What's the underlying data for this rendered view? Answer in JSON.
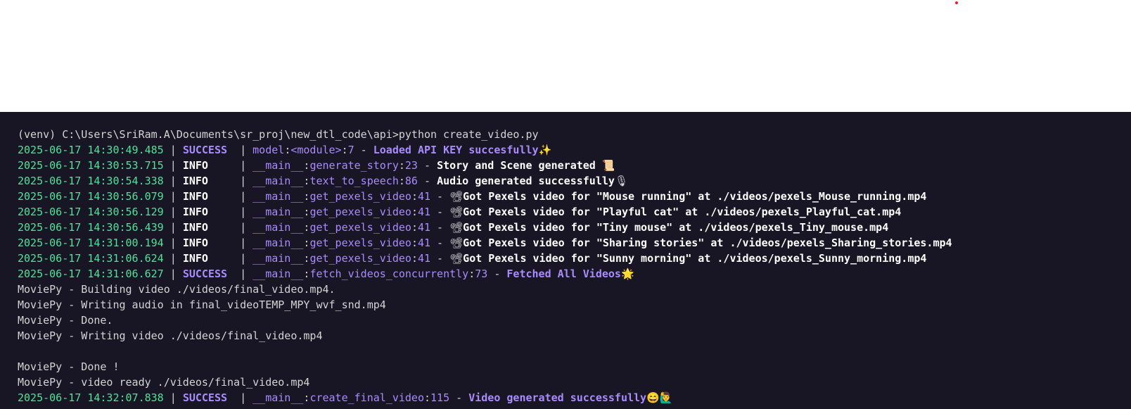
{
  "terminal": {
    "command_line": "(venv) C:\\Users\\SriRam.A\\Documents\\sr_proj\\new_dtl_code\\api>python create_video.py",
    "log_lines": [
      {
        "timestamp": "2025-06-17 14:30:49.485",
        "level": "SUCCESS ",
        "module": "model",
        "function": "<module>",
        "line": "7",
        "message": "Loaded API KEY succesfully",
        "emoji": "✨",
        "kind": "success"
      },
      {
        "timestamp": "2025-06-17 14:30:53.715",
        "level": "INFO    ",
        "module": "__main__",
        "function": "generate_story",
        "line": "23",
        "message": "Story and Scene generated ",
        "emoji": "📜",
        "kind": "info"
      },
      {
        "timestamp": "2025-06-17 14:30:54.338",
        "level": "INFO    ",
        "module": "__main__",
        "function": "text_to_speech",
        "line": "86",
        "message": "Audio generated successfully",
        "emoji": "🎙",
        "kind": "info"
      },
      {
        "timestamp": "2025-06-17 14:30:56.079",
        "level": "INFO    ",
        "module": "__main__",
        "function": "get_pexels_video",
        "line": "41",
        "message": "Got Pexels video for \"Mouse running\" at ./videos/pexels_Mouse_running.mp4",
        "emoji": "📽",
        "kind": "info",
        "emoji_first": true
      },
      {
        "timestamp": "2025-06-17 14:30:56.129",
        "level": "INFO    ",
        "module": "__main__",
        "function": "get_pexels_video",
        "line": "41",
        "message": "Got Pexels video for \"Playful cat\" at ./videos/pexels_Playful_cat.mp4",
        "emoji": "📽",
        "kind": "info",
        "emoji_first": true
      },
      {
        "timestamp": "2025-06-17 14:30:56.439",
        "level": "INFO    ",
        "module": "__main__",
        "function": "get_pexels_video",
        "line": "41",
        "message": "Got Pexels video for \"Tiny mouse\" at ./videos/pexels_Tiny_mouse.mp4",
        "emoji": "📽",
        "kind": "info",
        "emoji_first": true
      },
      {
        "timestamp": "2025-06-17 14:31:00.194",
        "level": "INFO    ",
        "module": "__main__",
        "function": "get_pexels_video",
        "line": "41",
        "message": "Got Pexels video for \"Sharing stories\" at ./videos/pexels_Sharing_stories.mp4",
        "emoji": "📽",
        "kind": "info",
        "emoji_first": true
      },
      {
        "timestamp": "2025-06-17 14:31:06.624",
        "level": "INFO    ",
        "module": "__main__",
        "function": "get_pexels_video",
        "line": "41",
        "message": "Got Pexels video for \"Sunny morning\" at ./videos/pexels_Sunny_morning.mp4",
        "emoji": "📽",
        "kind": "info",
        "emoji_first": true
      },
      {
        "timestamp": "2025-06-17 14:31:06.627",
        "level": "SUCCESS ",
        "module": "__main__",
        "function": "fetch_videos_concurrently",
        "line": "73",
        "message": "Fetched All Videos",
        "emoji": "🌟",
        "kind": "success"
      }
    ],
    "moviepy_lines": [
      "MoviePy - Building video ./videos/final_video.mp4.",
      "MoviePy - Writing audio in final_videoTEMP_MPY_wvf_snd.mp4",
      "MoviePy - Done.",
      "MoviePy - Writing video ./videos/final_video.mp4",
      "",
      "MoviePy - Done !",
      "MoviePy - video ready ./videos/final_video.mp4"
    ],
    "final_line": {
      "timestamp": "2025-06-17 14:32:07.838",
      "level": "SUCCESS ",
      "module": "__main__",
      "function": "create_final_video",
      "line": "115",
      "message": "Video generated successfully",
      "emoji": "😄🙋‍♂️",
      "kind": "success"
    },
    "colors": {
      "background": "#181624",
      "timestamp": "#4ee39a",
      "accent": "#a98bff",
      "text": "#d4d4d4"
    }
  }
}
